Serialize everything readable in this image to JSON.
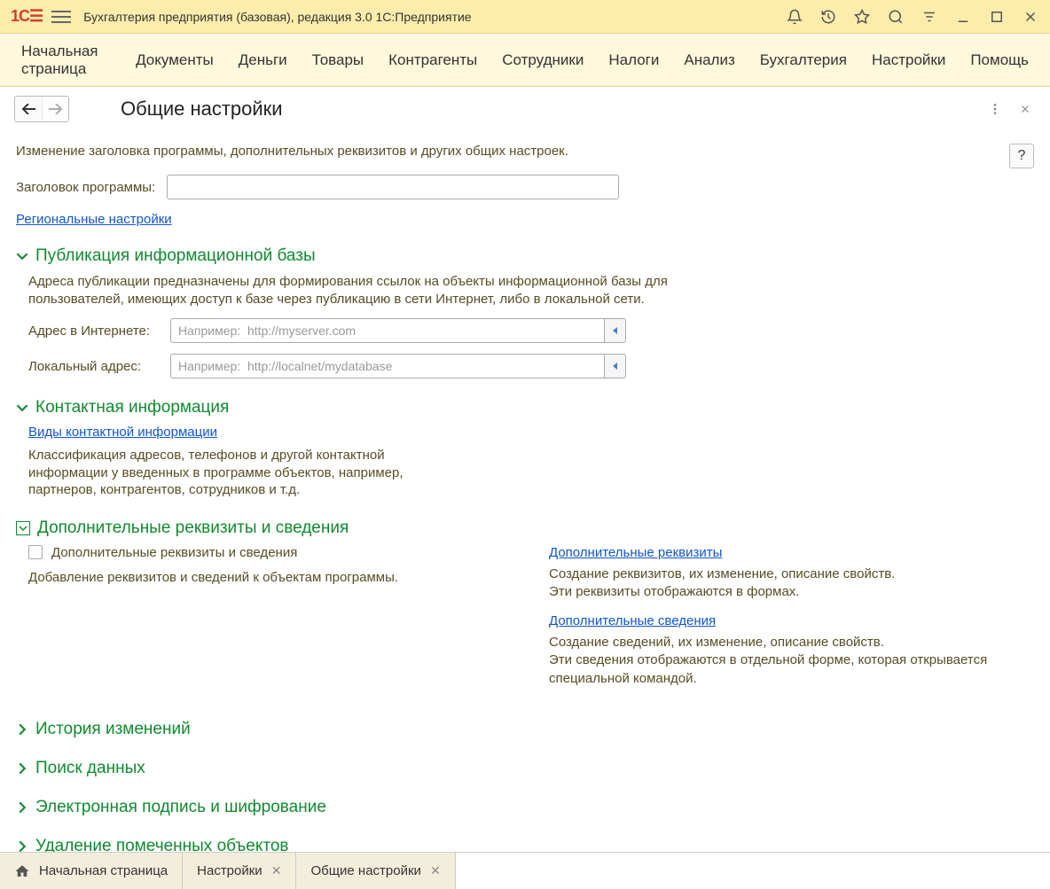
{
  "titlebar": {
    "app_title": "Бухгалтерия предприятия (базовая), редакция 3.0 1С:Предприятие"
  },
  "main_menu": [
    "Начальная страница",
    "Документы",
    "Деньги",
    "Товары",
    "Контрагенты",
    "Сотрудники",
    "Налоги",
    "Анализ",
    "Бухгалтерия",
    "Настройки",
    "Помощь"
  ],
  "page": {
    "title": "Общие настройки",
    "desc": "Изменение заголовка программы, дополнительных реквизитов и других общих настроек.",
    "help_label": "?"
  },
  "form": {
    "program_title_label": "Заголовок программы:",
    "regional_link": "Региональные настройки"
  },
  "publication": {
    "title": "Публикация информационной базы",
    "desc": "Адреса публикации предназначены для формирования ссылок на объекты информационной базы для пользователей, имеющих доступ к базе через публикацию в сети Интернет, либо в локальной сети.",
    "internet_label": "Адрес в Интернете:",
    "internet_placeholder": "Например:  http://myserver.com",
    "local_label": "Локальный адрес:",
    "local_placeholder": "Например:  http://localnet/mydatabase"
  },
  "contact": {
    "title": "Контактная информация",
    "types_link": "Виды контактной информации",
    "desc": "Классификация адресов, телефонов и другой контактной информации у введенных в программе объектов, например, партнеров, контрагентов, сотрудников и т.д."
  },
  "additional": {
    "title": "Дополнительные реквизиты и сведения",
    "checkbox_label": "Дополнительные реквизиты и сведения",
    "left_desc": "Добавление реквизитов и сведений к объектам программы.",
    "req_link": "Дополнительные реквизиты",
    "req_desc": "Создание реквизитов, их изменение, описание свойств.\nЭти реквизиты отображаются в формах.",
    "info_link": "Дополнительные сведения",
    "info_desc": "Создание сведений, их изменение, описание свойств.\nЭти сведения отображаются в отдельной форме, которая открывается специальной командой."
  },
  "collapsed_sections": [
    "История изменений",
    "Поиск данных",
    "Электронная подпись и шифрование",
    "Удаление помеченных объектов"
  ],
  "bottom_tabs": {
    "home": "Начальная страница",
    "settings": "Настройки",
    "general": "Общие настройки"
  }
}
